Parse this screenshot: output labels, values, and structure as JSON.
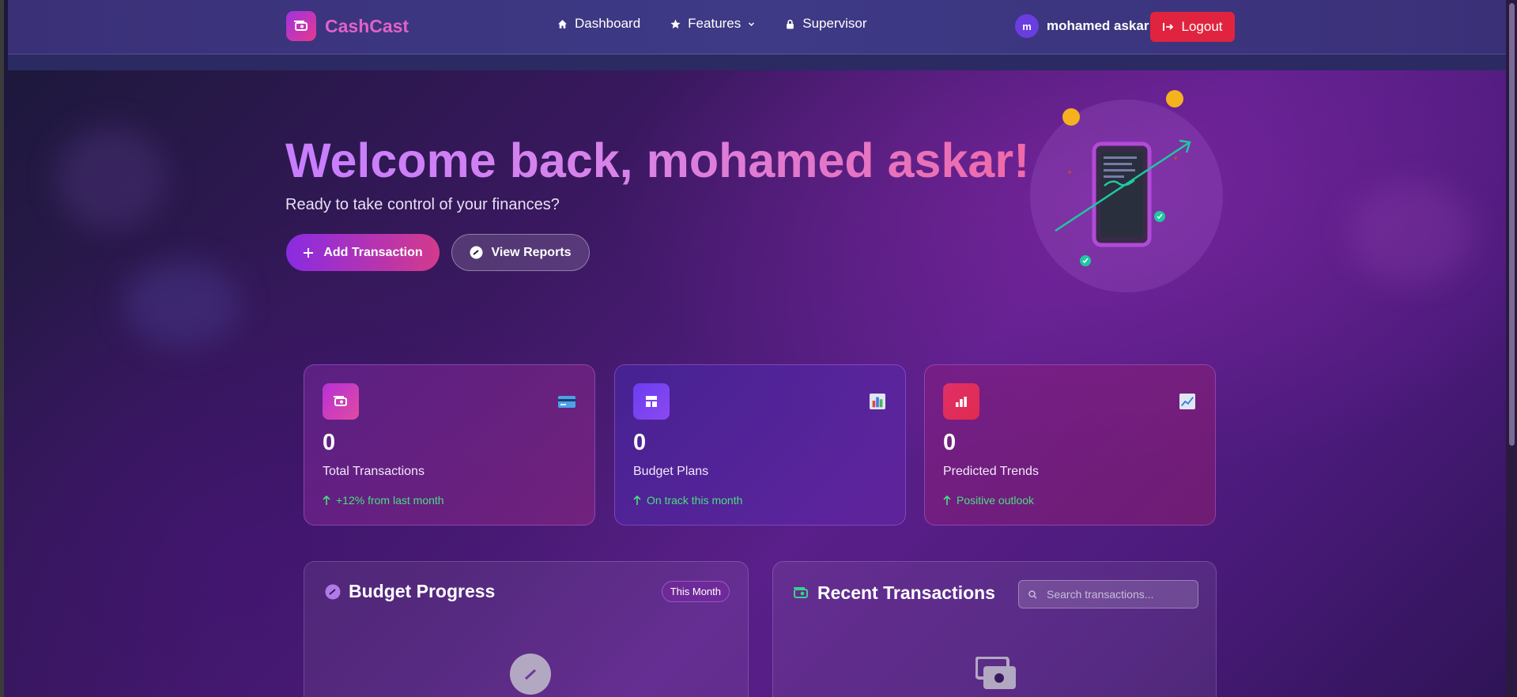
{
  "brand": {
    "name": "CashCast"
  },
  "nav": {
    "links": [
      {
        "label": "Dashboard",
        "icon": "home-icon"
      },
      {
        "label": "Features",
        "icon": "star-icon"
      },
      {
        "label": "Supervisor",
        "icon": "lock-icon"
      }
    ]
  },
  "user": {
    "initial": "m",
    "name": "mohamed askar",
    "logout_label": "Logout"
  },
  "hero": {
    "title": "Welcome back, mohamed askar!",
    "subtitle": "Ready to take control of your finances?",
    "primary_button": "Add Transaction",
    "secondary_button": "View Reports"
  },
  "stats": [
    {
      "value": "0",
      "label": "Total Transactions",
      "trend": "+12% from last month",
      "icon": "wallet-icon",
      "emoji": "credit-card-icon"
    },
    {
      "value": "0",
      "label": "Budget Plans",
      "trend": "On track this month",
      "icon": "layout-icon",
      "emoji": "bar-chart-icon"
    },
    {
      "value": "0",
      "label": "Predicted Trends",
      "trend": "Positive outlook",
      "icon": "chart-icon",
      "emoji": "trend-chart-icon"
    }
  ],
  "budget": {
    "title": "Budget Progress",
    "period": "This Month"
  },
  "recent": {
    "title": "Recent Transactions",
    "search_placeholder": "Search transactions..."
  },
  "colors": {
    "accent": "#c77dff",
    "pink": "#f06aa8",
    "logout": "#e0243f",
    "trend": "#4ade80"
  }
}
